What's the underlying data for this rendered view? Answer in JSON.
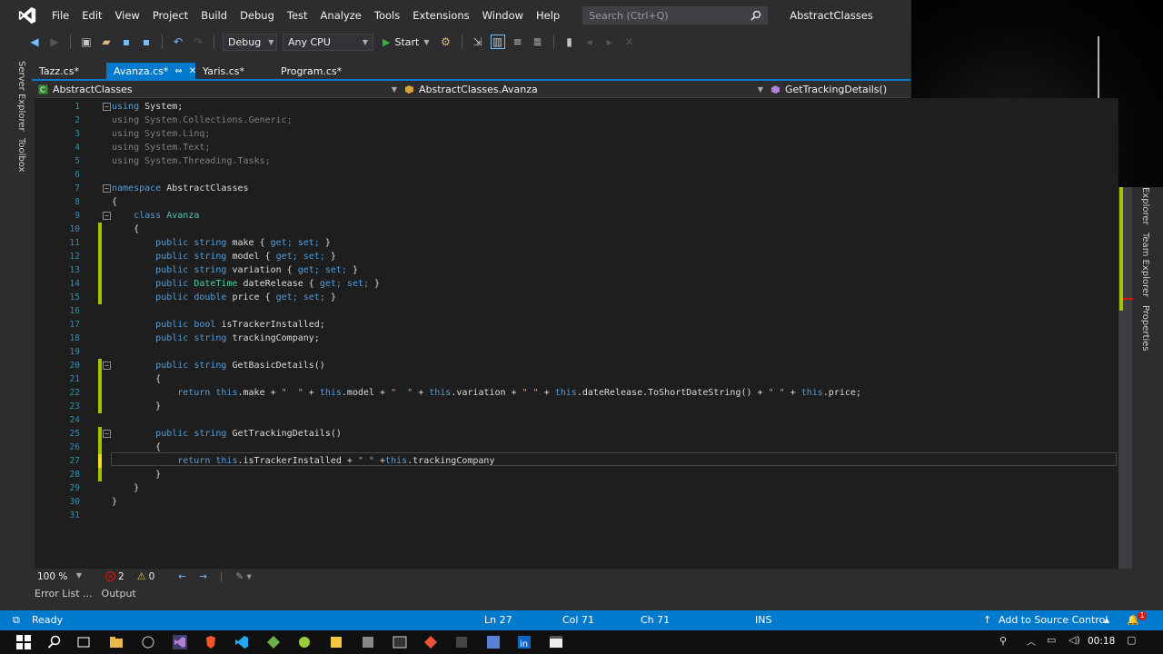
{
  "menu": {
    "items": [
      "File",
      "Edit",
      "View",
      "Project",
      "Build",
      "Debug",
      "Test",
      "Analyze",
      "Tools",
      "Extensions",
      "Window",
      "Help"
    ],
    "search_placeholder": "Search (Ctrl+Q)",
    "solution_name": "AbstractClasses"
  },
  "toolbar": {
    "config": "Debug",
    "platform": "Any CPU",
    "start_label": "Start"
  },
  "left_tool_windows": [
    "Server Explorer",
    "Toolbox"
  ],
  "right_tool_windows": [
    "Explorer",
    "Team Explorer",
    "Properties"
  ],
  "tabs": [
    {
      "label": "Tazz.cs*"
    },
    {
      "label": "Avanza.cs*",
      "active": true
    },
    {
      "label": "Yaris.cs*"
    },
    {
      "label": "Program.cs*"
    }
  ],
  "navbar": {
    "project": "AbstractClasses",
    "class": "AbstractClasses.Avanza",
    "member": "GetTrackingDetails()"
  },
  "code_lines": [
    {
      "n": "1"
    },
    {
      "n": "2"
    },
    {
      "n": "3"
    },
    {
      "n": "4"
    },
    {
      "n": "5"
    },
    {
      "n": "6"
    },
    {
      "n": "7"
    },
    {
      "n": "8"
    },
    {
      "n": "9"
    },
    {
      "n": "10"
    },
    {
      "n": "11"
    },
    {
      "n": "12"
    },
    {
      "n": "13"
    },
    {
      "n": "14"
    },
    {
      "n": "15"
    },
    {
      "n": "16"
    },
    {
      "n": "17"
    },
    {
      "n": "18"
    },
    {
      "n": "19"
    },
    {
      "n": "20"
    },
    {
      "n": "21"
    },
    {
      "n": "22"
    },
    {
      "n": "23"
    },
    {
      "n": "24"
    },
    {
      "n": "25"
    },
    {
      "n": "26"
    },
    {
      "n": "27"
    },
    {
      "n": "28"
    },
    {
      "n": "29"
    },
    {
      "n": "30"
    },
    {
      "n": "31"
    }
  ],
  "code": {
    "l1a": "using",
    "l1b": " System;",
    "l2a": "using",
    "l2b": " System.Collections.Generic;",
    "l3a": "using",
    "l3b": " System.Linq;",
    "l4a": "using",
    "l4b": " System.Text;",
    "l5a": "using",
    "l5b": " System.Threading.Tasks;",
    "l7a": "namespace",
    "l7b": " AbstractClasses",
    "l8": "{",
    "l9a": "class",
    "l9b": "Avanza",
    "l10": "{",
    "l11a": "public",
    "l11b": "string",
    "l11c": " make {",
    "l11d": " get;",
    "l11e": " set;",
    "l11f": " }",
    "l12a": "public",
    "l12b": "string",
    "l12c": " model {",
    "l12d": " get;",
    "l12e": " set;",
    "l12f": " }",
    "l13a": "public",
    "l13b": "string",
    "l13c": " variation {",
    "l13d": " get;",
    "l13e": " set;",
    "l13f": " }",
    "l14a": "public",
    "l14b": "DateTime",
    "l14c": " dateRelease {",
    "l14d": " get;",
    "l14e": " set;",
    "l14f": " }",
    "l15a": "public",
    "l15b": "double",
    "l15c": " price {",
    "l15d": " get;",
    "l15e": " set;",
    "l15f": " }",
    "l17a": "public",
    "l17b": "bool",
    "l17c": " isTrackerInstalled;",
    "l18a": "public",
    "l18b": "string",
    "l18c": " trackingCompany;",
    "l20a": "public",
    "l20b": "string",
    "l20c": " GetBasicDetails()",
    "l21": "{",
    "l22a": "return",
    "l22b": " this",
    "l22c": ".make + ",
    "l22d": "\"  \"",
    "l22e": " + ",
    "l22f": "this",
    "l22g": ".model + ",
    "l22h": "\"  \"",
    "l22i": " + ",
    "l22j": "this",
    "l22k": ".variation + ",
    "l22l": "\" \"",
    "l22m": " + ",
    "l22n": "this",
    "l22o": ".dateRelease.ToShortDateString() + ",
    "l22p": "\" \"",
    "l22q": " + ",
    "l22r": "this",
    "l22s": ".price;",
    "l23": "}",
    "l25a": "public",
    "l25b": "string",
    "l25c": " GetTrackingDetails()",
    "l26": "{",
    "l27a": "return",
    "l27b": " this",
    "l27c": ".isTrackerInstalled + ",
    "l27d": "\" \"",
    "l27e": " +",
    "l27f": "this",
    "l27g": ".trackingCompany",
    "l28": "}",
    "l29": "}",
    "l30": "}"
  },
  "editor_status": {
    "zoom": "100 %",
    "errors": "2",
    "warnings": "0"
  },
  "bottom_tabs": [
    "Error List ...",
    "Output"
  ],
  "statusbar": {
    "state": "Ready",
    "ln": "Ln 27",
    "col": "Col 71",
    "ch": "Ch 71",
    "mode": "INS",
    "source_control": "Add to Source Control",
    "notification_count": "1"
  },
  "taskbar": {
    "time": "00:18"
  },
  "colors": {
    "accent": "#007acc",
    "keyword": "#569cd6",
    "type": "#4ec9b0",
    "string": "#d69d85",
    "change_saved": "#a3c400",
    "change_unsaved": "#efdf1a"
  }
}
